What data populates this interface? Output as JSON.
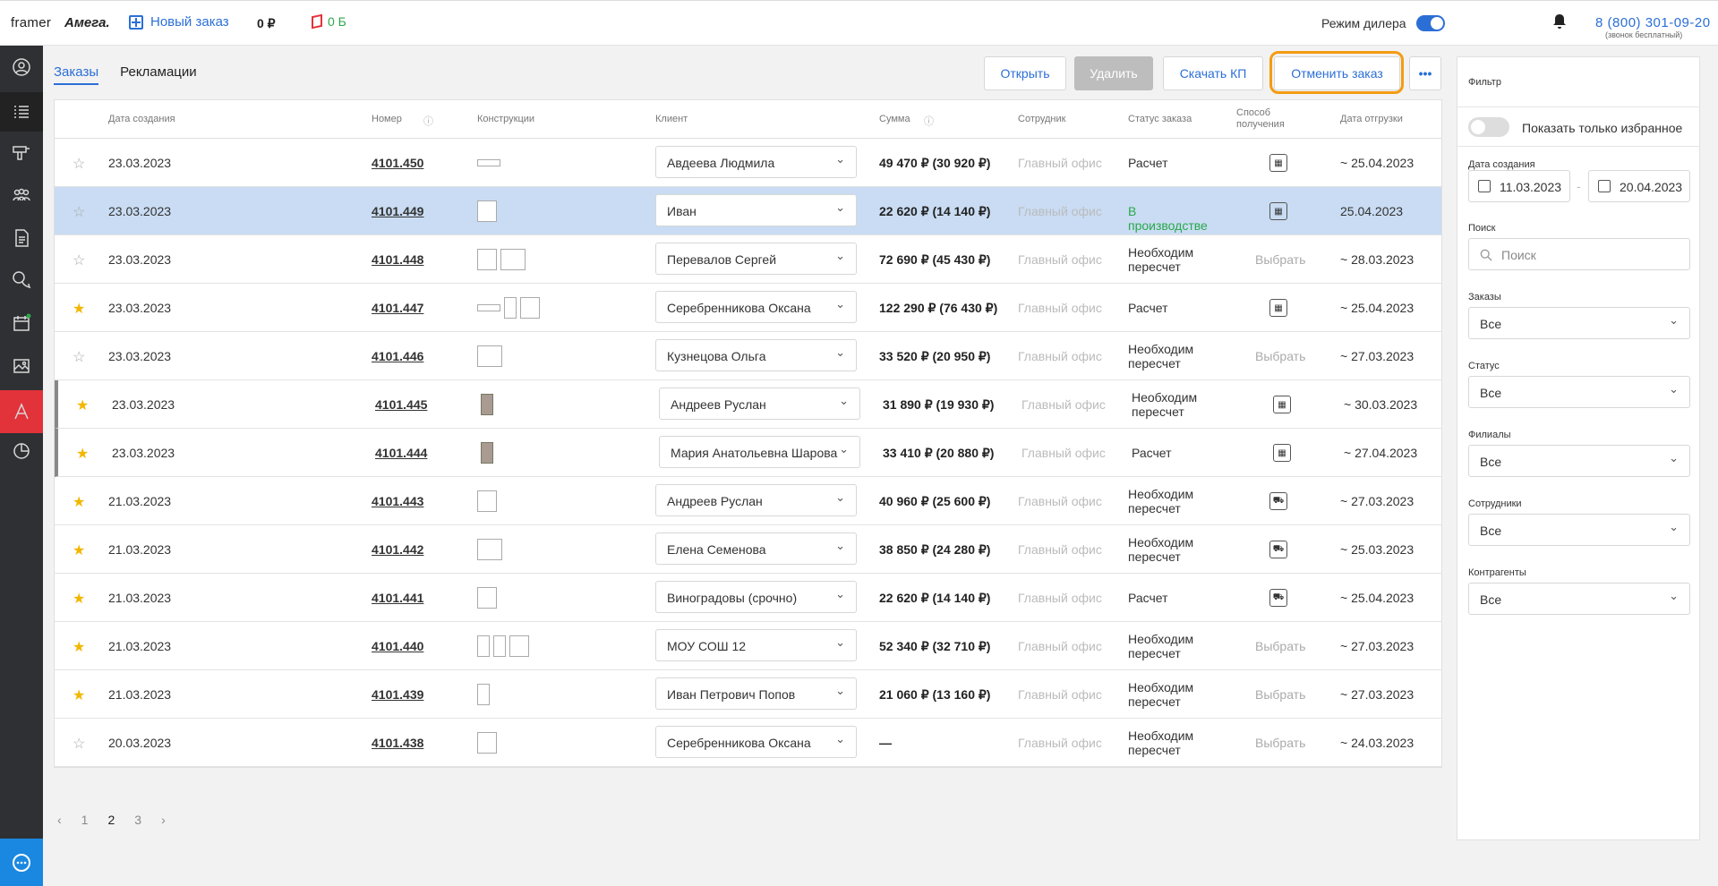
{
  "header": {
    "brand_left": "framer",
    "brand_right": "Амега.",
    "new_order": "Новый заказ",
    "balance": "0 ₽",
    "bonus": "0 Б",
    "dealer_mode": "Режим дилера",
    "phone": "8 (800) 301-09-20",
    "phone_note": "(звонок бесплатный)"
  },
  "tabs": [
    {
      "label": "Заказы"
    },
    {
      "label": "Рекламации"
    }
  ],
  "toolbar": {
    "open": "Открыть",
    "delete": "Удалить",
    "download": "Скачать КП",
    "cancel": "Отменить заказ",
    "more": "•••"
  },
  "columns": {
    "date": "Дата создания",
    "number": "Номер",
    "constructions": "Конструкции",
    "client": "Клиент",
    "sum": "Сумма",
    "employee": "Сотрудник",
    "status": "Статус заказа",
    "delivery": "Способ получения",
    "ship": "Дата отгрузки"
  },
  "rows": [
    {
      "star": "☆",
      "date": "23.03.2023",
      "num": "4101.450",
      "client": "Авдеева Людмила",
      "sum": "49 470 ₽ (30 920 ₽)",
      "emp": "Главный офис",
      "status": "Расчет",
      "delivery": "warehouse-icon",
      "ship": "~ 25.04.2023"
    },
    {
      "star": "☆",
      "date": "23.03.2023",
      "num": "4101.449",
      "client": "Иван",
      "sum": "22 620 ₽ (14 140 ₽)",
      "emp": "Главный офис",
      "status": "В производстве",
      "delivery": "warehouse-icon",
      "ship": "25.04.2023"
    },
    {
      "star": "☆",
      "date": "23.03.2023",
      "num": "4101.448",
      "client": "Перевалов Сергей",
      "sum": "72 690 ₽ (45 430 ₽)",
      "emp": "Главный офис",
      "status": "Необходим пересчет",
      "delivery": "Выбрать",
      "ship": "~ 28.03.2023"
    },
    {
      "star": "★",
      "date": "23.03.2023",
      "num": "4101.447",
      "client": "Серебренникова Оксана",
      "sum": "122 290 ₽ (76 430 ₽)",
      "emp": "Главный офис",
      "status": "Расчет",
      "delivery": "warehouse-icon",
      "ship": "~ 25.04.2023"
    },
    {
      "star": "☆",
      "date": "23.03.2023",
      "num": "4101.446",
      "client": "Кузнецова Ольга",
      "sum": "33 520 ₽ (20 950 ₽)",
      "emp": "Главный офис",
      "status": "Необходим пересчет",
      "delivery": "Выбрать",
      "ship": "~ 27.03.2023"
    },
    {
      "star": "★",
      "date": "23.03.2023",
      "num": "4101.445",
      "client": "Андреев Руслан",
      "sum": "31 890 ₽ (19 930 ₽)",
      "emp": "Главный офис",
      "status": "Необходим пересчет",
      "delivery": "warehouse-icon",
      "ship": "~ 30.03.2023"
    },
    {
      "star": "★",
      "date": "23.03.2023",
      "num": "4101.444",
      "client": "Мария Анатольевна Шарова",
      "sum": "33 410 ₽ (20 880 ₽)",
      "emp": "Главный офис",
      "status": "Расчет",
      "delivery": "warehouse-icon",
      "ship": "~ 27.04.2023"
    },
    {
      "star": "★",
      "date": "21.03.2023",
      "num": "4101.443",
      "client": "Андреев Руслан",
      "sum": "40 960 ₽ (25 600 ₽)",
      "emp": "Главный офис",
      "status": "Необходим пересчет",
      "delivery": "truck-icon",
      "ship": "~ 27.03.2023"
    },
    {
      "star": "★",
      "date": "21.03.2023",
      "num": "4101.442",
      "client": "Елена Семенова",
      "sum": "38 850 ₽ (24 280 ₽)",
      "emp": "Главный офис",
      "status": "Необходим пересчет",
      "delivery": "truck-icon",
      "ship": "~ 25.03.2023"
    },
    {
      "star": "★",
      "date": "21.03.2023",
      "num": "4101.441",
      "client": "Виноградовы (срочно)",
      "sum": "22 620 ₽ (14 140 ₽)",
      "emp": "Главный офис",
      "status": "Расчет",
      "delivery": "truck-icon",
      "ship": "~ 25.04.2023"
    },
    {
      "star": "★",
      "date": "21.03.2023",
      "num": "4101.440",
      "client": "МОУ СОШ 12",
      "sum": "52 340 ₽ (32 710 ₽)",
      "emp": "Главный офис",
      "status": "Необходим пересчет",
      "delivery": "Выбрать",
      "ship": "~ 27.03.2023"
    },
    {
      "star": "★",
      "date": "21.03.2023",
      "num": "4101.439",
      "client": "Иван Петрович Попов",
      "sum": "21 060 ₽ (13 160 ₽)",
      "emp": "Главный офис",
      "status": "Необходим пересчет",
      "delivery": "Выбрать",
      "ship": "~ 27.03.2023"
    },
    {
      "star": "☆",
      "date": "20.03.2023",
      "num": "4101.438",
      "client": "Серебренникова Оксана",
      "sum": "—",
      "emp": "Главный офис",
      "status": "Необходим пересчет",
      "delivery": "Выбрать",
      "ship": "~ 24.03.2023"
    }
  ],
  "pager": {
    "prev": "‹",
    "p1": "1",
    "p2": "2",
    "p3": "3",
    "next": "›"
  },
  "filter": {
    "title": "Фильтр",
    "fav": "Показать только избранное",
    "date_label": "Дата создания",
    "date_from": "11.03.2023",
    "date_to": "20.04.2023",
    "search_label": "Поиск",
    "search_placeholder": "Поиск",
    "orders_label": "Заказы",
    "orders": "Все",
    "status_label": "Статус",
    "status": "Все",
    "branches_label": "Филиалы",
    "branches": "Все",
    "employees_label": "Сотрудники",
    "employees": "Все",
    "counterparties_label": "Контрагенты",
    "counterparties": "Все"
  }
}
